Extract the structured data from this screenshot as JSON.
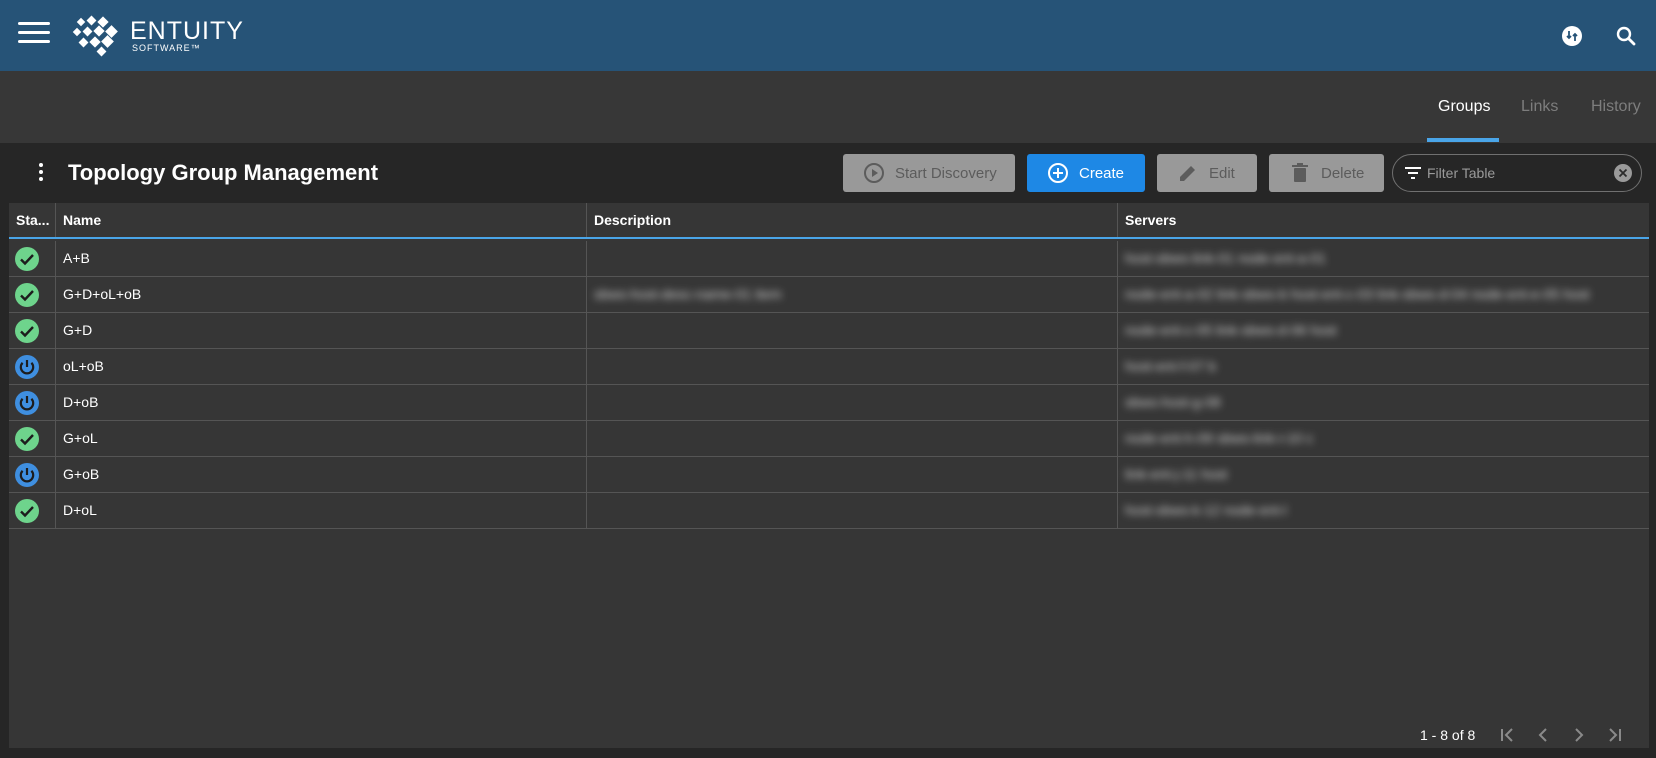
{
  "app": {
    "logo_name": "ENTUITY",
    "logo_sub": "SOFTWARE™",
    "brand_color": "#265377",
    "accent_color": "#4aa5e8",
    "status_ok_color": "#6ed48c",
    "status_stopped_color": "#3f8fe0"
  },
  "tabs": [
    {
      "label": "Groups",
      "active": true
    },
    {
      "label": "Links",
      "active": false
    },
    {
      "label": "History",
      "active": false
    }
  ],
  "page": {
    "title": "Topology Group Management"
  },
  "toolbar": {
    "start_discovery_label": "Start Discovery",
    "create_label": "Create",
    "edit_label": "Edit",
    "delete_label": "Delete",
    "filter_placeholder": "Filter Table"
  },
  "table": {
    "columns": [
      "Sta...",
      "Name",
      "Description",
      "Servers"
    ],
    "rows": [
      {
        "status": "ok",
        "name": "A+B",
        "description": "",
        "servers": "host-sbws-link-01 node-ent-a-01"
      },
      {
        "status": "ok",
        "name": "G+D+oL+oB",
        "description": "sbws-host-desc-name-01 item",
        "servers": "node-ent-a-02 link-sbws-b host-ent-c-03 link-sbws-d-04 node-ent-e-05 host"
      },
      {
        "status": "ok",
        "name": "G+D",
        "description": "",
        "servers": "node-ent-c-05 link-sbws-d-06 host"
      },
      {
        "status": "stopped",
        "name": "oL+oB",
        "description": "",
        "servers": "host-ent-f-07 b"
      },
      {
        "status": "stopped",
        "name": "D+oB",
        "description": "",
        "servers": "sbws-host-g-08"
      },
      {
        "status": "ok",
        "name": "G+oL",
        "description": "",
        "servers": "node-ent-h-09 sbws-link-i-10 c"
      },
      {
        "status": "stopped",
        "name": "G+oB",
        "description": "",
        "servers": "link-ent-j-11 host"
      },
      {
        "status": "ok",
        "name": "D+oL",
        "description": "",
        "servers": "host-sbws-k-12 node-ent-l"
      }
    ]
  },
  "pager": {
    "count_text": "1 - 8 of 8"
  },
  "icons": {
    "menu": "hamburger-menu-icon",
    "update": "sync-icon",
    "search": "search-icon",
    "more": "kebab-menu-icon",
    "play": "play-circle-icon",
    "add": "add-circle-icon",
    "edit": "pencil-icon",
    "delete": "trash-icon",
    "filter": "filter-icon",
    "clear": "clear-circle-icon",
    "ok": "check-circle-icon",
    "stopped": "power-circle-icon"
  }
}
